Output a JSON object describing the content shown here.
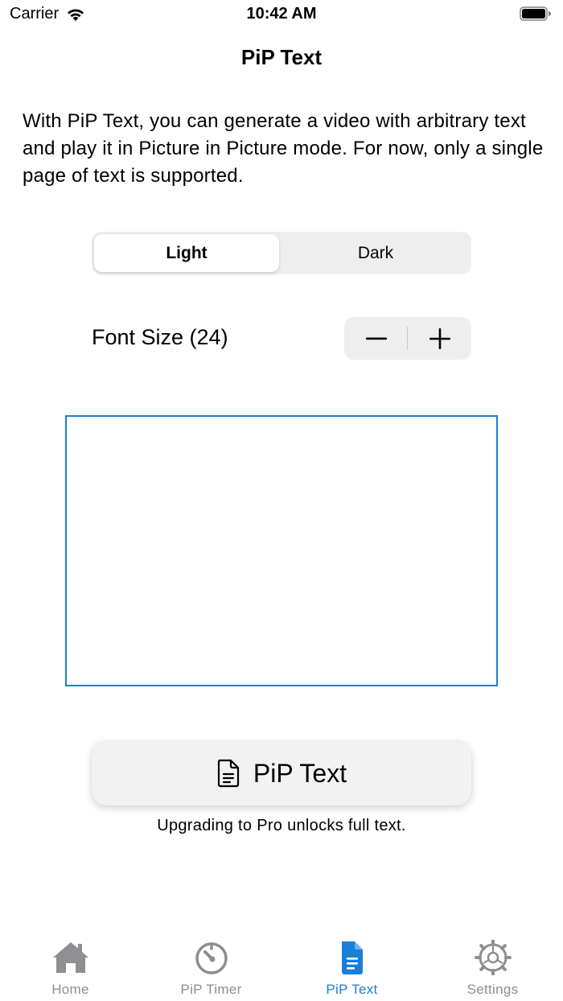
{
  "status_bar": {
    "carrier": "Carrier",
    "time": "10:42 AM"
  },
  "nav": {
    "title": "PiP Text"
  },
  "description": "With PiP Text, you can generate a video with arbitrary text and play it in Picture in Picture mode. For now, only a single page of text is supported.",
  "theme_segment": {
    "options": [
      "Light",
      "Dark"
    ],
    "selected": "Light"
  },
  "font_size": {
    "label": "Font Size (24)",
    "value": 24
  },
  "text_editor": {
    "value": ""
  },
  "primary_button": {
    "label": "PiP Text",
    "icon": "document-icon"
  },
  "note": "Upgrading to Pro unlocks full text.",
  "tab_bar": {
    "items": [
      {
        "label": "Home",
        "icon": "house-icon",
        "active": false
      },
      {
        "label": "PiP Timer",
        "icon": "timer-icon",
        "active": false
      },
      {
        "label": "PiP Text",
        "icon": "document-icon",
        "active": true
      },
      {
        "label": "Settings",
        "icon": "gear-icon",
        "active": false
      }
    ]
  },
  "colors": {
    "accent": "#1a7fd6",
    "inactive": "#8e8e93",
    "control_background": "#eeeeef"
  }
}
